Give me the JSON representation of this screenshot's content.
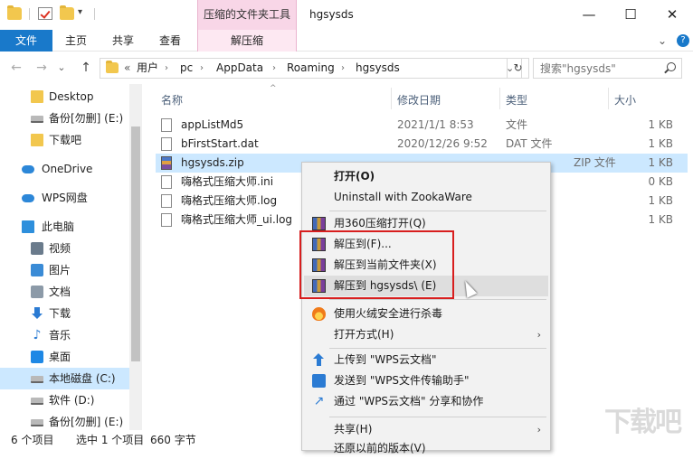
{
  "titlebar": {
    "context_tab_label": "压缩的文件夹工具",
    "window_title": "hgsysds",
    "controls": {
      "minimize": "—",
      "maximize": "☐",
      "close": "✕"
    }
  },
  "ribbon": {
    "tabs": [
      "文件",
      "主页",
      "共享",
      "查看",
      "解压缩"
    ],
    "expand_glyph": "⌄",
    "help_glyph": "?"
  },
  "address": {
    "back": "←",
    "forward": "→",
    "recent": "⌄",
    "up": "↑",
    "overflow": "«",
    "crumbs": [
      "用户",
      "pc",
      "AppData",
      "Roaming",
      "hgsysds"
    ],
    "crumb_sep": "›",
    "dropdown": "⌄",
    "refresh": "↻",
    "search_placeholder": "搜索\"hgsysds\""
  },
  "nav": {
    "items": [
      {
        "label": "Desktop",
        "icon": "folder-icon"
      },
      {
        "label": "备份[勿删] (E:)",
        "icon": "drive-icon"
      },
      {
        "label": "下载吧",
        "icon": "folder-icon"
      },
      {
        "label": "OneDrive",
        "icon": "cloud-icon"
      },
      {
        "label": "WPS网盘",
        "icon": "cloud-icon"
      },
      {
        "label": "此电脑",
        "icon": "pc-icon"
      },
      {
        "label": "视频",
        "icon": "video-icon"
      },
      {
        "label": "图片",
        "icon": "pictures-icon"
      },
      {
        "label": "文档",
        "icon": "documents-icon"
      },
      {
        "label": "下载",
        "icon": "download-icon"
      },
      {
        "label": "音乐",
        "icon": "music-icon"
      },
      {
        "label": "桌面",
        "icon": "desktop-icon"
      },
      {
        "label": "本地磁盘 (C:)",
        "icon": "drive-icon"
      },
      {
        "label": "软件 (D:)",
        "icon": "drive-icon"
      },
      {
        "label": "备份[勿删] (E:)",
        "icon": "drive-icon"
      }
    ],
    "selected_index": 12
  },
  "filelist": {
    "headers": {
      "name": "名称",
      "date": "修改日期",
      "type": "类型",
      "size": "大小"
    },
    "sort_glyph": "^",
    "rows": [
      {
        "name": "appListMd5",
        "date": "2021/1/1 8:53",
        "type": "文件",
        "size": "1 KB"
      },
      {
        "name": "bFirstStart.dat",
        "date": "2020/12/26 9:52",
        "type": "DAT 文件",
        "size": "1 KB"
      },
      {
        "name": "hgsysds.zip",
        "date": "",
        "type": "ZIP 文件",
        "size": "1 KB"
      },
      {
        "name": "嗨格式压缩大师.ini",
        "date": "",
        "type": "",
        "size": "0 KB"
      },
      {
        "name": "嗨格式压缩大师.log",
        "date": "",
        "type": "",
        "size": "1 KB"
      },
      {
        "name": "嗨格式压缩大师_ui.log",
        "date": "",
        "type": "",
        "size": "1 KB"
      }
    ],
    "selected_index": 2
  },
  "status": {
    "count": "6 个项目",
    "selected": "选中 1 个项目",
    "size": "660 字节"
  },
  "context_menu": {
    "items": [
      {
        "label": "打开(O)",
        "bold": true
      },
      {
        "label": "Uninstall with ZookaWare"
      },
      {
        "label": "用360压缩打开(Q)"
      },
      {
        "label": "解压到(F)..."
      },
      {
        "label": "解压到当前文件夹(X)"
      },
      {
        "label": "解压到 hgsysds\\ (E)"
      },
      {
        "label": "使用火绒安全进行杀毒"
      },
      {
        "label": "打开方式(H)"
      },
      {
        "label": "上传到 \"WPS云文档\""
      },
      {
        "label": "发送到 \"WPS文件传输助手\""
      },
      {
        "label": "通过 \"WPS云文档\" 分享和协作"
      },
      {
        "label": "共享(H)"
      },
      {
        "label": "还原以前的版本(V)"
      }
    ],
    "submenu_arrow": "›"
  },
  "watermark": "下载吧"
}
